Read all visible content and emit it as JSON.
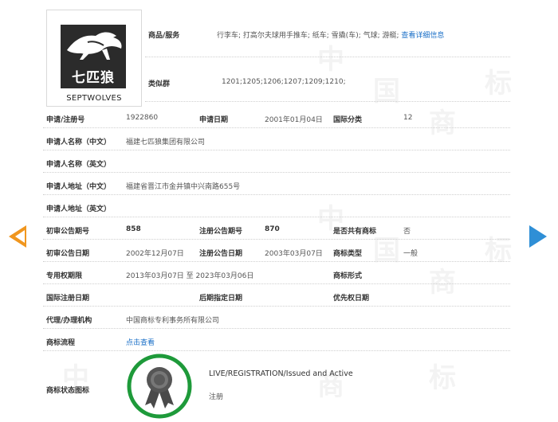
{
  "logo": {
    "text_cn": "七匹狼",
    "text_en": "SEPTWOLVES"
  },
  "goods": {
    "label": "商品/服务",
    "value": "行李车; 打高尔夫球用手推车; 纸车; 雪撬(车); 气球; 游艇;",
    "link": "查看详细信息"
  },
  "similar_group": {
    "label": "类似群",
    "value": "1201;1205;1206;1207;1209;1210;"
  },
  "rows": {
    "reg_no": {
      "label": "申请/注册号",
      "value": "1922860"
    },
    "apply_date": {
      "label": "申请日期",
      "value": "2001年01月04日"
    },
    "intl_class": {
      "label": "国际分类",
      "value": "12"
    },
    "applicant_cn": {
      "label": "申请人名称（中文）",
      "value": "福建七匹狼集团有限公司"
    },
    "applicant_en": {
      "label": "申请人名称（英文）",
      "value": ""
    },
    "address_cn": {
      "label": "申请人地址（中文）",
      "value": "福建省晋江市金井镇中兴南路655号"
    },
    "address_en": {
      "label": "申请人地址（英文）",
      "value": ""
    },
    "prelim_no": {
      "label": "初审公告期号",
      "value": "858"
    },
    "reg_notice_no": {
      "label": "注册公告期号",
      "value": "870"
    },
    "shared": {
      "label": "是否共有商标",
      "value": "否"
    },
    "prelim_date": {
      "label": "初审公告日期",
      "value": "2002年12月07日"
    },
    "reg_notice_date": {
      "label": "注册公告日期",
      "value": "2003年03月07日"
    },
    "mark_type": {
      "label": "商标类型",
      "value": "一般"
    },
    "exclusive_period": {
      "label": "专用权期限",
      "value": "2013年03月07日 至 2023年03月06日"
    },
    "mark_form": {
      "label": "商标形式",
      "value": ""
    },
    "intl_reg_date": {
      "label": "国际注册日期",
      "value": ""
    },
    "later_date": {
      "label": "后期指定日期",
      "value": ""
    },
    "priority_date": {
      "label": "优先权日期",
      "value": ""
    },
    "agent": {
      "label": "代理/办理机构",
      "value": "中国商标专利事务所有限公司"
    },
    "process": {
      "label": "商标流程",
      "link": "点击查看"
    },
    "status_icon": {
      "label": "商标状态图标",
      "status_en": "LIVE/REGISTRATION/Issued and Active",
      "status_cn": "注册"
    }
  },
  "watermark": [
    "中",
    "国",
    "商",
    "标"
  ],
  "colors": {
    "link": "#1a6fc7",
    "prev_arrow": "#f0961e",
    "next_arrow": "#2f8fd6",
    "badge_ring": "#1e9a3a"
  },
  "icons": {
    "prev": "chevron-left-icon",
    "next": "chevron-right-icon",
    "badge": "ribbon-badge-icon"
  }
}
